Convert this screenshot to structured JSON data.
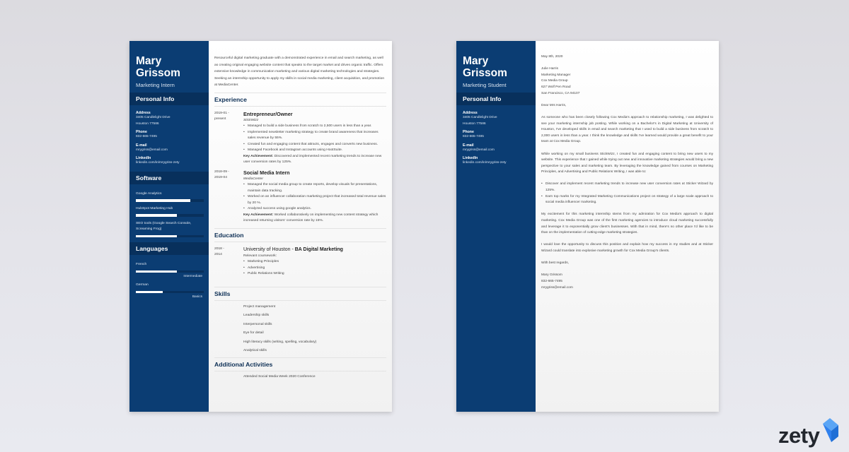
{
  "resume": {
    "name_line1": "Mary",
    "name_line2": "Grissom",
    "job_title": "Marketing Intern",
    "personal_info": {
      "heading": "Personal Info",
      "address_label": "Address",
      "address_line1": "3405 Candlelight Drive",
      "address_line2": "Houston 77586",
      "phone_label": "Phone",
      "phone": "832-665-7495",
      "email_label": "E-mail",
      "email": "mrygriss@email.com",
      "linkedin_label": "LinkedIn",
      "linkedin": "linkedin.com/in/mrygriss-zety"
    },
    "software": {
      "heading": "Software",
      "items": [
        {
          "name": "Google Analytics",
          "level": 0.8
        },
        {
          "name": "HubSpot Marketing Hub",
          "level": 0.6
        },
        {
          "name": "SEO tools (Google Search Console, Screaming Frog)",
          "level": 0.6
        }
      ]
    },
    "languages": {
      "heading": "Languages",
      "items": [
        {
          "name": "French",
          "level": 0.6,
          "level_label": "Intermediate"
        },
        {
          "name": "German",
          "level": 0.4,
          "level_label": "Basics"
        }
      ]
    },
    "summary": "Resourceful digital marketing graduate with a demonstrated experience in email and search marketing, as well as creating original engaging website content that speaks to the target market and drives organic traffic. Offers extensive knowledge in communication marketing and various digital marketing technologies and strategies. Seeking an internship opportunity to apply my skills in social media marketing, client acquisition, and promotion at MediaCenter.",
    "experience": {
      "heading": "Experience",
      "entries": [
        {
          "date_start": "2019-01 -",
          "date_end": "present",
          "title": "Entrepreneur/Owner",
          "company": "StickWizz",
          "bullets": [
            "Managed to build a side business from scratch to 2,500 users in less than a year.",
            "Implemented newsletter marketing strategy to create brand awareness that increases sales revenue by 55%.",
            "Created fun and engaging content that attracts, engages and converts new business.",
            "Managed Facebook and Instagram accounts using HootSuite."
          ],
          "achievement_label": "Key Achievement:",
          "achievement": "Discovered and implemented recent marketing trends to increase new user conversion rates by 125%."
        },
        {
          "date_start": "2018-09 -",
          "date_end": "2019-04",
          "title": "Social Media Intern",
          "company": "MediaCenter",
          "bullets": [
            "Managed the social media group to create reports, develop visuals for presentations, maintain data tracking.",
            "Worked on an influencer collaboration marketing project that increased total revenue sales by 20 %.",
            "Analyzed success using google analytics."
          ],
          "achievement_label": "Key Achievement:",
          "achievement": "Worked collaboratively on implementing new content strategy which increased returning visitors' conversion rate by 15%."
        }
      ]
    },
    "education": {
      "heading": "Education",
      "date_start": "2018 -",
      "date_end": "2014",
      "school": "University of Houston - ",
      "degree": "BA Digital Marketing",
      "coursework_label": "Relevant coursework:",
      "courses": [
        "Marketing Principles",
        "Advertising",
        "Public Relations Writing"
      ]
    },
    "skills": {
      "heading": "Skills",
      "items": [
        "Project management",
        "Leadership skills",
        "Interpersonal skills",
        "Eye for detail",
        "High literacy skills (writing, spelling, vocabulary)",
        "Analytical skills"
      ]
    },
    "activities": {
      "heading": "Additional Activities",
      "items": [
        "Attended Social Media Week 2020 Conference"
      ]
    }
  },
  "letter": {
    "name_line1": "Mary",
    "name_line2": "Grissom",
    "job_title": "Marketing Student",
    "personal_info": {
      "heading": "Personal Info",
      "address_label": "Address",
      "address_line1": "3405 Candlelight Drive",
      "address_line2": "Houston 77586",
      "phone_label": "Phone",
      "phone": "832-665-7495",
      "email_label": "E-mail",
      "email": "mrygriss@email.com",
      "linkedin_label": "LinkedIn",
      "linkedin": "linkedin.com/in/mrygriss-zety"
    },
    "date": "May 8th, 2020",
    "recipient": [
      "Julie Harris",
      "Marketing Manager",
      "Cox Media Group",
      "627 Wolf Pen Road",
      "San Francisco, CA 94107"
    ],
    "salutation": "Dear Mrs Harris,",
    "p1": "As someone who has been closely following Cox Media's approach to relationship marketing, I was delighted to see your marketing internship job posting. While working on a Bachelor's in Digital Marketing at University of Houston, I've developed skills in email and search marketing that I used to build a side business from scratch to 2,000 users in less than a year. I think the knowledge and skills I've learned would provide a great benefit to your team at Cox Media Group.",
    "p2": "While working on my small business StickWizz, I created fun and engaging content to bring new users to my website. This experience that I gained while trying out new and innovative marketing strategies would bring a new perspective to your sales and marketing team. By leveraging the knowledge gained from courses on Marketing Principles, and Advertising and Public Relations Writing, I was able to:",
    "bullets": [
      "Discover and implement recent marketing trends to increase new user conversion rates at Sticker Wizard by 125%.",
      "Earn top marks for my Integrated Marketing Communications project on strategy of a large scale approach to social media influencer marketing."
    ],
    "p3": "My excitement for this marketing internship stems from my admiration for Cox Media's approach to digital marketing. Cox Media Group was one of the first marketing agencies to introduce cloud marketing successfully and leverage it to exponentially grow client's businesses. With that in mind, there's no other place I'd like to be than on the implementation of cutting-edge marketing strategies.",
    "p4": "I would love the opportunity to discuss this position and explain how my success in my studies and at Sticker Wizard could translate into explosive marketing growth for Cox Media Group's clients.",
    "closing": "With best regards,",
    "signature": [
      "Mary Grissom",
      "832-665-7495",
      "mrygriss@email.com"
    ]
  },
  "brand": {
    "logo_text": "zety",
    "logo_icon": "zety-flag-icon",
    "accent": "#2f80ed",
    "sidebar_color": "#0b3d73"
  }
}
